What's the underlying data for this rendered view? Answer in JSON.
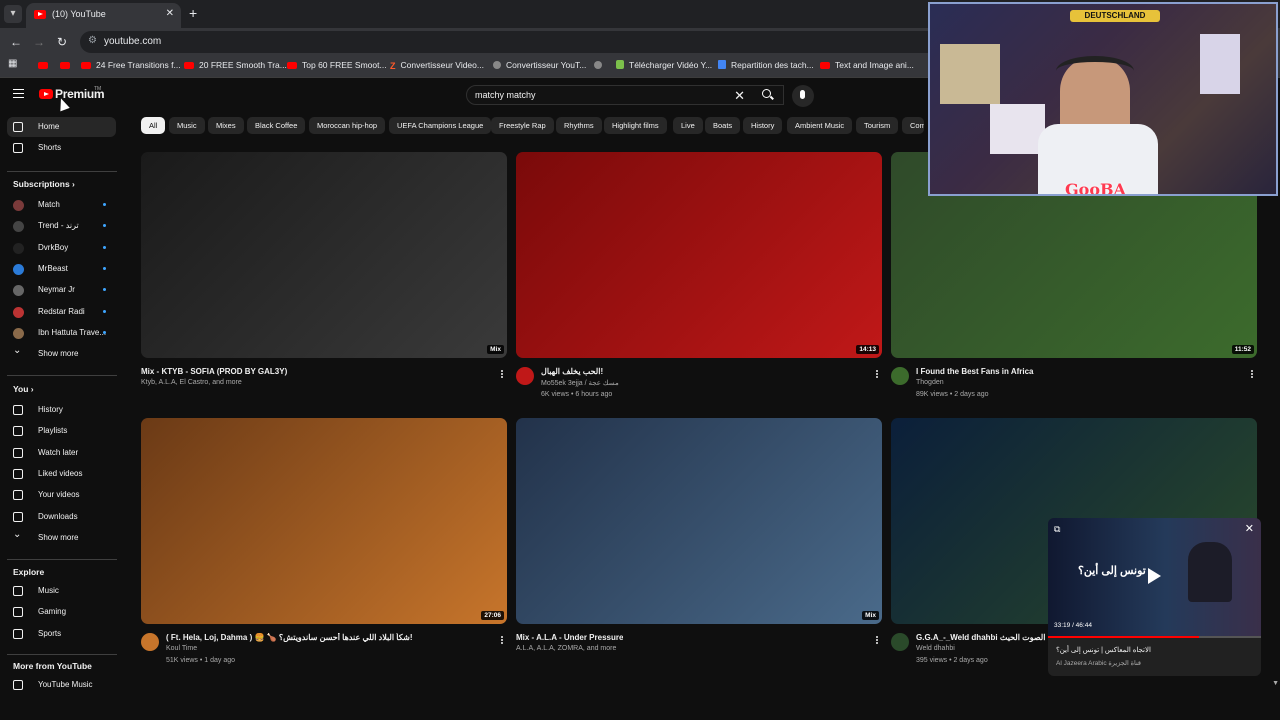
{
  "browser": {
    "tab_title": "(10) YouTube",
    "url": "youtube.com",
    "bookmarks": [
      {
        "label": "",
        "icon": "youtube-icon"
      },
      {
        "label": "",
        "icon": "youtube-icon"
      },
      {
        "label": "24 Free Transitions f...",
        "icon": "youtube-icon"
      },
      {
        "label": "20 FREE Smooth Tra...",
        "icon": "youtube-icon"
      },
      {
        "label": "Top 60 FREE Smoot...",
        "icon": "youtube-icon"
      },
      {
        "label": "Convertisseur Video...",
        "icon": "z-icon"
      },
      {
        "label": "Convertisseur YouT...",
        "icon": "converter-icon"
      },
      {
        "label": "",
        "icon": "globe-icon"
      },
      {
        "label": "Télécharger Vidéo Y...",
        "icon": "download-icon"
      },
      {
        "label": "Repartition des tach...",
        "icon": "doc-icon"
      },
      {
        "label": "Text and Image ani...",
        "icon": "youtube-icon"
      }
    ]
  },
  "header": {
    "logo_text": "Premium",
    "tm": "TM",
    "search_query": "matchy matchy"
  },
  "sidebar": {
    "main": [
      {
        "label": "Home",
        "icon": "home-icon",
        "active": true
      },
      {
        "label": "Shorts",
        "icon": "shorts-icon"
      }
    ],
    "subscriptions_title": "Subscriptions",
    "subscriptions": [
      {
        "label": "Match",
        "color": "#7a3a3a"
      },
      {
        "label": "Trend - ترند",
        "color": "#444444"
      },
      {
        "label": "DvrkBoy",
        "color": "#222222"
      },
      {
        "label": "MrBeast",
        "color": "#2b7bd8"
      },
      {
        "label": "Neymar Jr",
        "color": "#666666"
      },
      {
        "label": "Redstar Radi",
        "color": "#b33"
      },
      {
        "label": "Ibn Hattuta Trave...",
        "color": "#8a6a4a"
      }
    ],
    "subs_show_more": "Show more",
    "you_title": "You",
    "you": [
      {
        "label": "History",
        "icon": "history-icon"
      },
      {
        "label": "Playlists",
        "icon": "playlists-icon"
      },
      {
        "label": "Watch later",
        "icon": "watch-later-icon"
      },
      {
        "label": "Liked videos",
        "icon": "like-icon"
      },
      {
        "label": "Your videos",
        "icon": "your-videos-icon"
      },
      {
        "label": "Downloads",
        "icon": "download-icon"
      }
    ],
    "you_show_more": "Show more",
    "explore_title": "Explore",
    "explore": [
      {
        "label": "Music",
        "icon": "music-icon"
      },
      {
        "label": "Gaming",
        "icon": "gaming-icon"
      },
      {
        "label": "Sports",
        "icon": "trophy-icon"
      }
    ],
    "more_title": "More from YouTube",
    "more": [
      {
        "label": "YouTube Music",
        "icon": "youtube-music-icon"
      }
    ]
  },
  "chips": [
    "All",
    "Music",
    "Mixes",
    "Black Coffee",
    "Moroccan hip-hop",
    "UEFA Champions League",
    "Freestyle Rap",
    "Rhythms",
    "Highlight films",
    "Live",
    "Boats",
    "History",
    "Ambient Music",
    "Tourism",
    "Comp"
  ],
  "videos": [
    {
      "title": "Mix - KTYB - SOFIA (PROD BY GAL3Y)",
      "channel": "Ktyb, A.L.A, El Castro, and more",
      "stats": "",
      "badge": "Mix",
      "colors": [
        "#1a1a1a",
        "#3a3a3a"
      ]
    },
    {
      "title": "الحب يخلف الهبال!",
      "channel": "Mo55ek 3ejja / مسك عجة",
      "stats": "6K views • 6 hours ago",
      "badge": "14:13",
      "colors": [
        "#7a0a0a",
        "#c01818"
      ]
    },
    {
      "title": "I Found the Best Fans in Africa",
      "channel": "Thogden",
      "stats": "89K views • 2 days ago",
      "badge": "11:52",
      "colors": [
        "#2f4a2a",
        "#3c6b2c"
      ]
    },
    {
      "title": "( Ft. Hela, Loj, Dahma ) 🍔 🍗 شكاً البلاد اللي عندها أحسن ساندويتش؟!",
      "channel": "Koul Time",
      "stats": "51K views • 1 day ago",
      "badge": "27:06",
      "colors": [
        "#6b3a16",
        "#c7752b"
      ]
    },
    {
      "title": "Mix - A.L.A - Under Pressure",
      "channel": "A.L.A, A.L.A, ZOMRA, and more",
      "stats": "",
      "badge": "Mix",
      "colors": [
        "#22324a",
        "#4a6a8a"
      ]
    },
    {
      "title": "G.G.A_-_Weld dhahbi الخ الصوت الحيث",
      "channel": "Weld dhahbi",
      "stats": "395 views • 2 days ago",
      "badge": "",
      "colors": [
        "#0b1f3a",
        "#2a4a2a"
      ]
    }
  ],
  "webcam": {
    "name_tag": "GooBA",
    "sign": "DEUTSCHLAND"
  },
  "miniplayer": {
    "time": "33:19 / 46:44",
    "title": "الاتجاه المعاكس | تونس إلى أين؟",
    "channel": "Al Jazeera Arabic قناة الجزيرة",
    "overlay_text": "تونس إلى أين؟"
  }
}
